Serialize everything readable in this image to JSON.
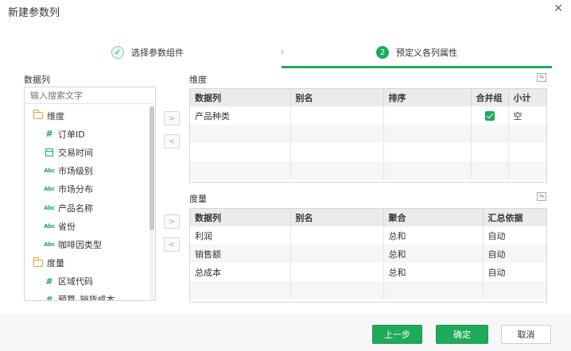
{
  "dialog": {
    "title": "新建参数列"
  },
  "wizard": {
    "steps": [
      {
        "number": "✓",
        "label": "选择参数组件"
      },
      {
        "number": "2",
        "label": "预定义各列属性"
      }
    ]
  },
  "left": {
    "section_label": "数据列",
    "search_placeholder": "输入搜索文字",
    "tree": [
      {
        "type": "folder",
        "label": "维度",
        "icon": "folder-icon"
      },
      {
        "type": "leaf",
        "label": "订单ID",
        "icon": "number-icon"
      },
      {
        "type": "leaf",
        "label": "交易时间",
        "icon": "date-icon"
      },
      {
        "type": "leaf",
        "label": "市场级别",
        "icon": "text-icon"
      },
      {
        "type": "leaf",
        "label": "市场分布",
        "icon": "text-icon"
      },
      {
        "type": "leaf",
        "label": "产品名称",
        "icon": "text-icon"
      },
      {
        "type": "leaf",
        "label": "省份",
        "icon": "text-icon"
      },
      {
        "type": "leaf",
        "label": "咖啡因类型",
        "icon": "text-icon"
      },
      {
        "type": "folder",
        "label": "度量",
        "icon": "folder-icon"
      },
      {
        "type": "leaf",
        "label": "区域代码",
        "icon": "number-icon"
      },
      {
        "type": "leaf",
        "label": "预算_销货成本",
        "icon": "number-icon"
      }
    ],
    "text_icon_glyph": "Abc"
  },
  "dimension": {
    "section_label": "维度",
    "columns": [
      "数据列",
      "别名",
      "排序",
      "合并组",
      "小计"
    ],
    "rows": [
      {
        "data_column": "产品种类",
        "alias": "",
        "sort": "",
        "merge_group": true,
        "subtotal": "空"
      }
    ]
  },
  "measure": {
    "section_label": "度量",
    "columns": [
      "数据列",
      "别名",
      "聚合",
      "汇总依据"
    ],
    "rows": [
      {
        "data_column": "利润",
        "alias": "",
        "aggregate": "总和",
        "summary_basis": "自动"
      },
      {
        "data_column": "销售额",
        "alias": "",
        "aggregate": "总和",
        "summary_basis": "自动"
      },
      {
        "data_column": "总成本",
        "alias": "",
        "aggregate": "总和",
        "summary_basis": "自动"
      }
    ]
  },
  "buttons": {
    "prev": "上一步",
    "ok": "确定",
    "cancel": "取消"
  },
  "colors": {
    "accent": "#1eaa5b",
    "folder": "#e8a13a"
  }
}
